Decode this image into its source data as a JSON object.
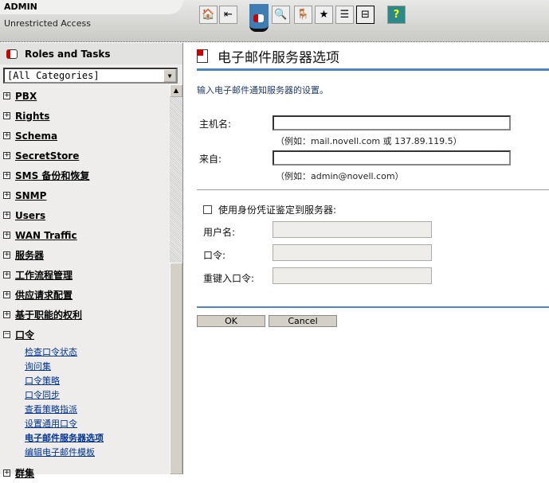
{
  "header": {
    "user": "ADMIN",
    "access": "Unrestricted Access"
  },
  "toolbar": [
    {
      "icon": "home-icon",
      "g": "🏠"
    },
    {
      "icon": "exit-icon",
      "g": "⇤"
    },
    {
      "icon": "search-object-icon",
      "g": "🔍"
    },
    {
      "icon": "desk-icon",
      "g": "🪑"
    },
    {
      "icon": "star-icon",
      "g": "★"
    },
    {
      "icon": "task-list-icon",
      "g": "☰"
    },
    {
      "icon": "network-icon",
      "g": "⊟"
    },
    {
      "icon": "help-icon",
      "g": "?"
    }
  ],
  "sidebar": {
    "title": "Roles and Tasks",
    "category": "[All Categories]",
    "nodes": [
      "PBX",
      "Rights",
      "Schema",
      "SecretStore",
      "SMS 备份和恢复",
      "SNMP",
      "Users",
      "WAN Traffic",
      "服务器",
      "工作流程管理",
      "供应请求配置",
      "基于职能的权利"
    ],
    "expanded": {
      "label": "口令",
      "items": [
        "检查口令状态",
        "询问集",
        "口令策略",
        "口令同步",
        "查看策略指派",
        "设置通用口令",
        "电子邮件服务器选项",
        "编辑电子邮件模板"
      ]
    },
    "last": "群集",
    "plus": "+",
    "minus": "−"
  },
  "main": {
    "title": "电子邮件服务器选项",
    "intro": "输入电子邮件通知服务器的设置。",
    "host_label": "主机名:",
    "host_value": "",
    "host_hint": "（例如：mail.novell.com 或 137.89.119.5）",
    "from_label": "来自:",
    "from_value": "",
    "from_hint": "（例如：admin@novell.com）",
    "auth_label": "使用身份凭证鉴定到服务器:",
    "auth_checked": false,
    "user_label": "用户名:",
    "pass_label": "口令:",
    "repass_label": "重键入口令:",
    "ok": "OK",
    "cancel": "Cancel"
  }
}
